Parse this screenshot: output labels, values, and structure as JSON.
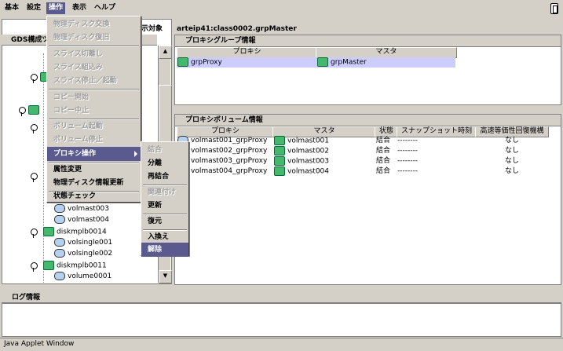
{
  "menubar": {
    "items": [
      "基本",
      "設定",
      "操作",
      "表示",
      "ヘルプ"
    ],
    "active_index": 2
  },
  "left_panel": {
    "header_tail": "示対象",
    "tab_label": "GDS構成ツ",
    "tree": {
      "volumes_a": [
        "volmast003",
        "volmast004"
      ],
      "disk1": "diskmplb0014",
      "volumes_b": [
        "volsingle001",
        "volsingle002"
      ],
      "disk2": "diskmplb0011",
      "volumes_c": [
        "volume0001"
      ]
    }
  },
  "right_title": "arteip41:class0002.grpMaster",
  "proxy_group": {
    "title": "プロキシグループ情報",
    "columns": [
      "プロキシ",
      "マスタ"
    ],
    "rows": [
      {
        "proxy": "grpProxy",
        "master": "grpMaster"
      }
    ]
  },
  "proxy_volume": {
    "title": "プロキシボリューム情報",
    "columns": [
      "プロキシ",
      "マスタ",
      "状態",
      "スナップショット時刻",
      "高速等価性回復機構"
    ],
    "rows": [
      {
        "proxy": "volmast001_grpProxy",
        "master": "volmast001",
        "state": "結合",
        "time": "--------",
        "fast": "なし"
      },
      {
        "proxy": "volmast002_grpProxy",
        "master": "volmast002",
        "state": "結合",
        "time": "--------",
        "fast": "なし"
      },
      {
        "proxy": "volmast003_grpProxy",
        "master": "volmast003",
        "state": "結合",
        "time": "--------",
        "fast": "なし"
      },
      {
        "proxy": "volmast004_grpProxy",
        "master": "volmast004",
        "state": "結合",
        "time": "--------",
        "fast": "なし"
      }
    ]
  },
  "log": {
    "title": "ログ情報"
  },
  "status_bar": "Java Applet Window",
  "operation_menu": {
    "items": [
      {
        "label": "物理ディスク交換",
        "enabled": false
      },
      {
        "label": "物理ディスク復旧",
        "enabled": false
      },
      {
        "label": "スライス切離し",
        "enabled": false
      },
      {
        "label": "スライス組込み",
        "enabled": false
      },
      {
        "label": "スライス停止／起動",
        "enabled": false
      },
      {
        "label": "コピー開始",
        "enabled": false
      },
      {
        "label": "コピー中止",
        "enabled": false
      },
      {
        "label": "ボリューム起動",
        "enabled": false
      },
      {
        "label": "ボリューム停止",
        "enabled": false
      },
      {
        "label": "プロキシ操作",
        "enabled": true,
        "highlighted": true
      },
      {
        "label": "属性変更",
        "enabled": true
      },
      {
        "label": "物理ディスク情報更新",
        "enabled": true
      },
      {
        "label": "状態チェック",
        "enabled": true
      }
    ]
  },
  "proxy_submenu": {
    "items": [
      {
        "label": "結合",
        "enabled": false
      },
      {
        "label": "分離",
        "enabled": true
      },
      {
        "label": "再結合",
        "enabled": true
      },
      {
        "label": "関連付け",
        "enabled": false
      },
      {
        "label": "更新",
        "enabled": true
      },
      {
        "label": "復元",
        "enabled": true
      },
      {
        "label": "入換え",
        "enabled": true
      },
      {
        "label": "解除",
        "enabled": true,
        "highlighted": true
      }
    ]
  },
  "colors": {
    "highlight": "#5a5a8e",
    "selected_row": "#ccccff",
    "background": "#d4d0c8"
  }
}
